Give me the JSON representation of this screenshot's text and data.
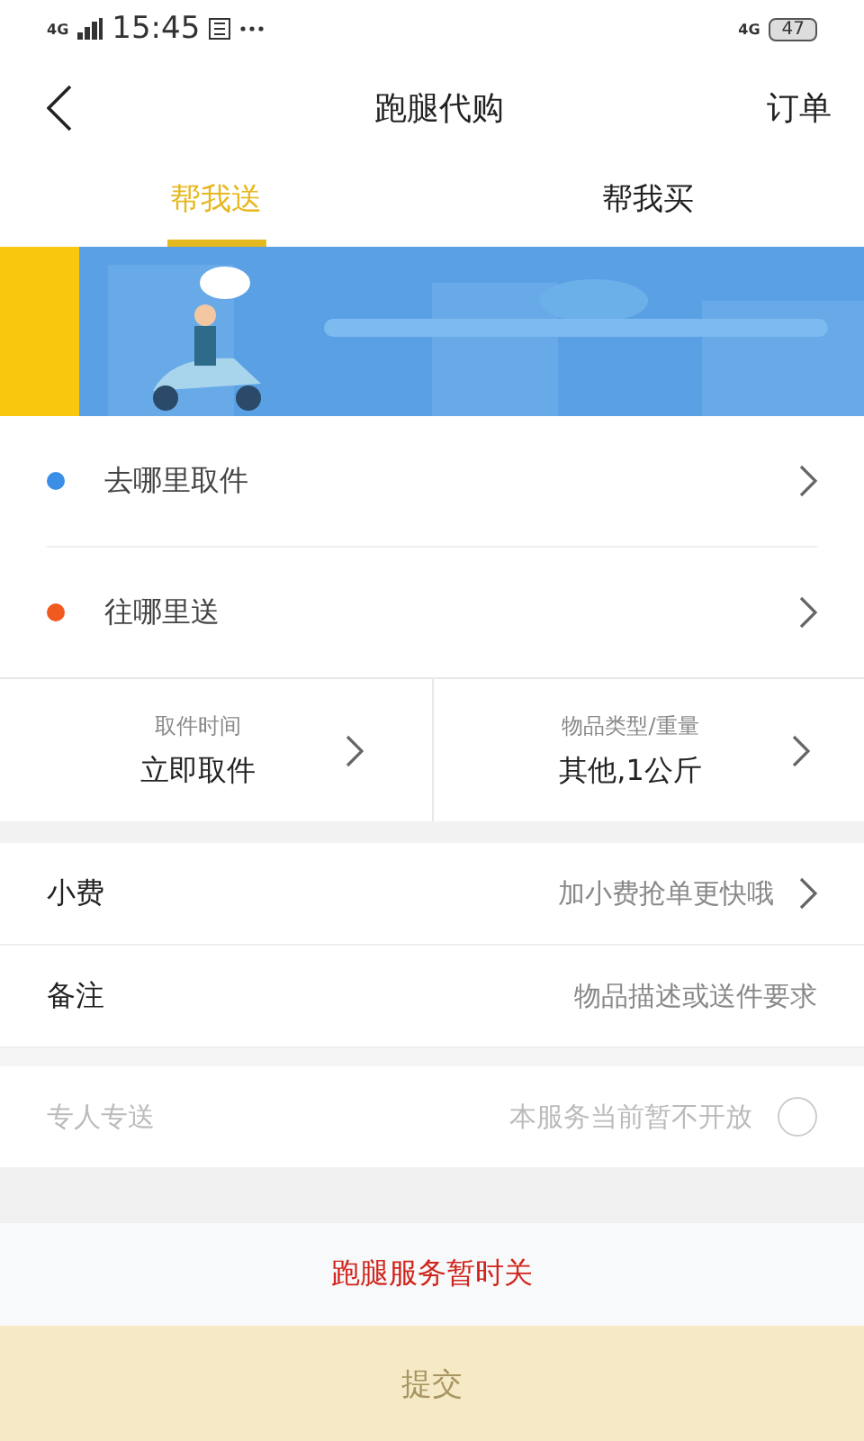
{
  "status_bar": {
    "network_left": "4G",
    "time": "15:45",
    "network_right": "4G",
    "battery": "47"
  },
  "header": {
    "title": "跑腿代购",
    "action": "订单"
  },
  "tabs": [
    {
      "label": "帮我送",
      "selected": true
    },
    {
      "label": "帮我买",
      "selected": false
    }
  ],
  "addresses": [
    {
      "label": "去哪里取件",
      "color": "#3a8ee6"
    },
    {
      "label": "往哪里送",
      "color": "#f05a1e"
    }
  ],
  "options": [
    {
      "caption": "取件时间",
      "value": "立即取件"
    },
    {
      "caption": "物品类型/重量",
      "value": "其他,1公斤"
    }
  ],
  "fields": [
    {
      "label": "小费",
      "kind": "link",
      "value": "加小费抢单更快哦"
    },
    {
      "label": "备注",
      "kind": "input",
      "placeholder": "物品描述或送件要求"
    }
  ],
  "private_delivery": {
    "label": "专人专送",
    "note": "本服务当前暂不开放",
    "disabled": true,
    "on": false
  },
  "notice": "跑腿服务暂时关",
  "submit": {
    "label": "提交",
    "disabled": true
  }
}
